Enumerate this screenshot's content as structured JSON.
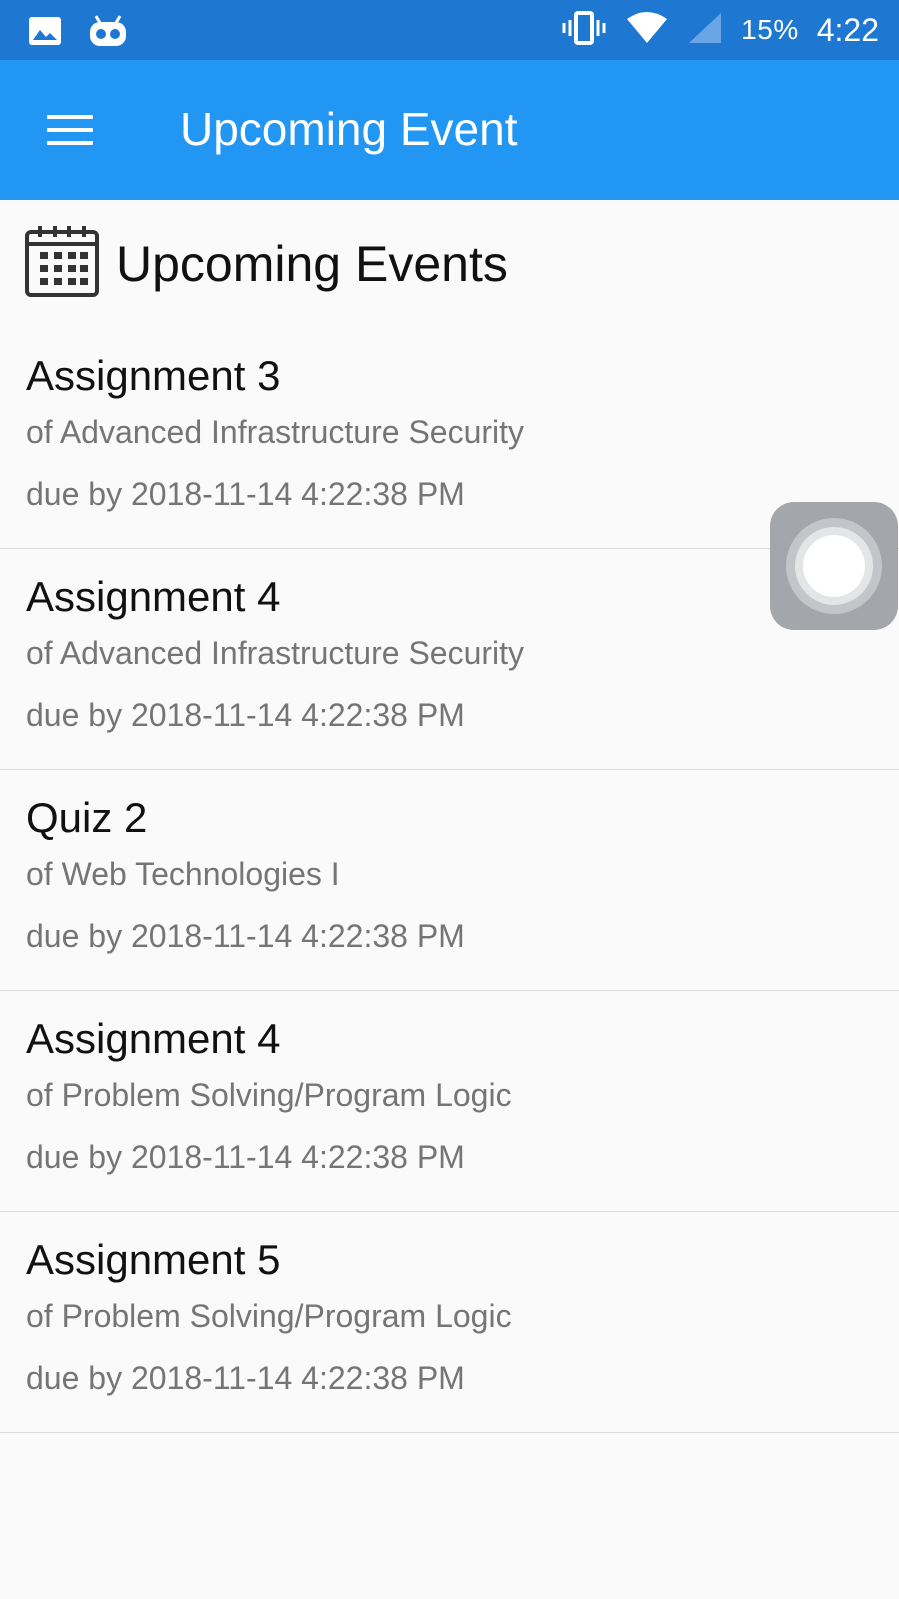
{
  "status_bar": {
    "battery": "15%",
    "time": "4:22",
    "icons": [
      "gallery-icon",
      "android-head-icon",
      "vibrate-icon",
      "wifi-icon",
      "cell-signal-icon"
    ]
  },
  "app_bar": {
    "title": "Upcoming Event",
    "menu_icon": "hamburger-menu-icon"
  },
  "section": {
    "icon": "calendar-icon",
    "title": "Upcoming Events"
  },
  "events": [
    {
      "title": "Assignment 3",
      "course": "of Advanced Infrastructure Security",
      "due": "due by 2018-11-14 4:22:38 PM"
    },
    {
      "title": "Assignment 4",
      "course": "of Advanced Infrastructure Security",
      "due": "due by 2018-11-14 4:22:38 PM"
    },
    {
      "title": "Quiz 2",
      "course": "of Web Technologies I",
      "due": "due by 2018-11-14 4:22:38 PM"
    },
    {
      "title": "Assignment 4",
      "course": "of Problem Solving/Program Logic",
      "due": "due by 2018-11-14 4:22:38 PM"
    },
    {
      "title": "Assignment 5",
      "course": "of Problem Solving/Program Logic",
      "due": "due by 2018-11-14 4:22:38 PM"
    }
  ],
  "colors": {
    "status_bar": "#1e78d2",
    "app_bar": "#2196f3",
    "background": "#fafafa",
    "secondary_text": "#757575"
  }
}
